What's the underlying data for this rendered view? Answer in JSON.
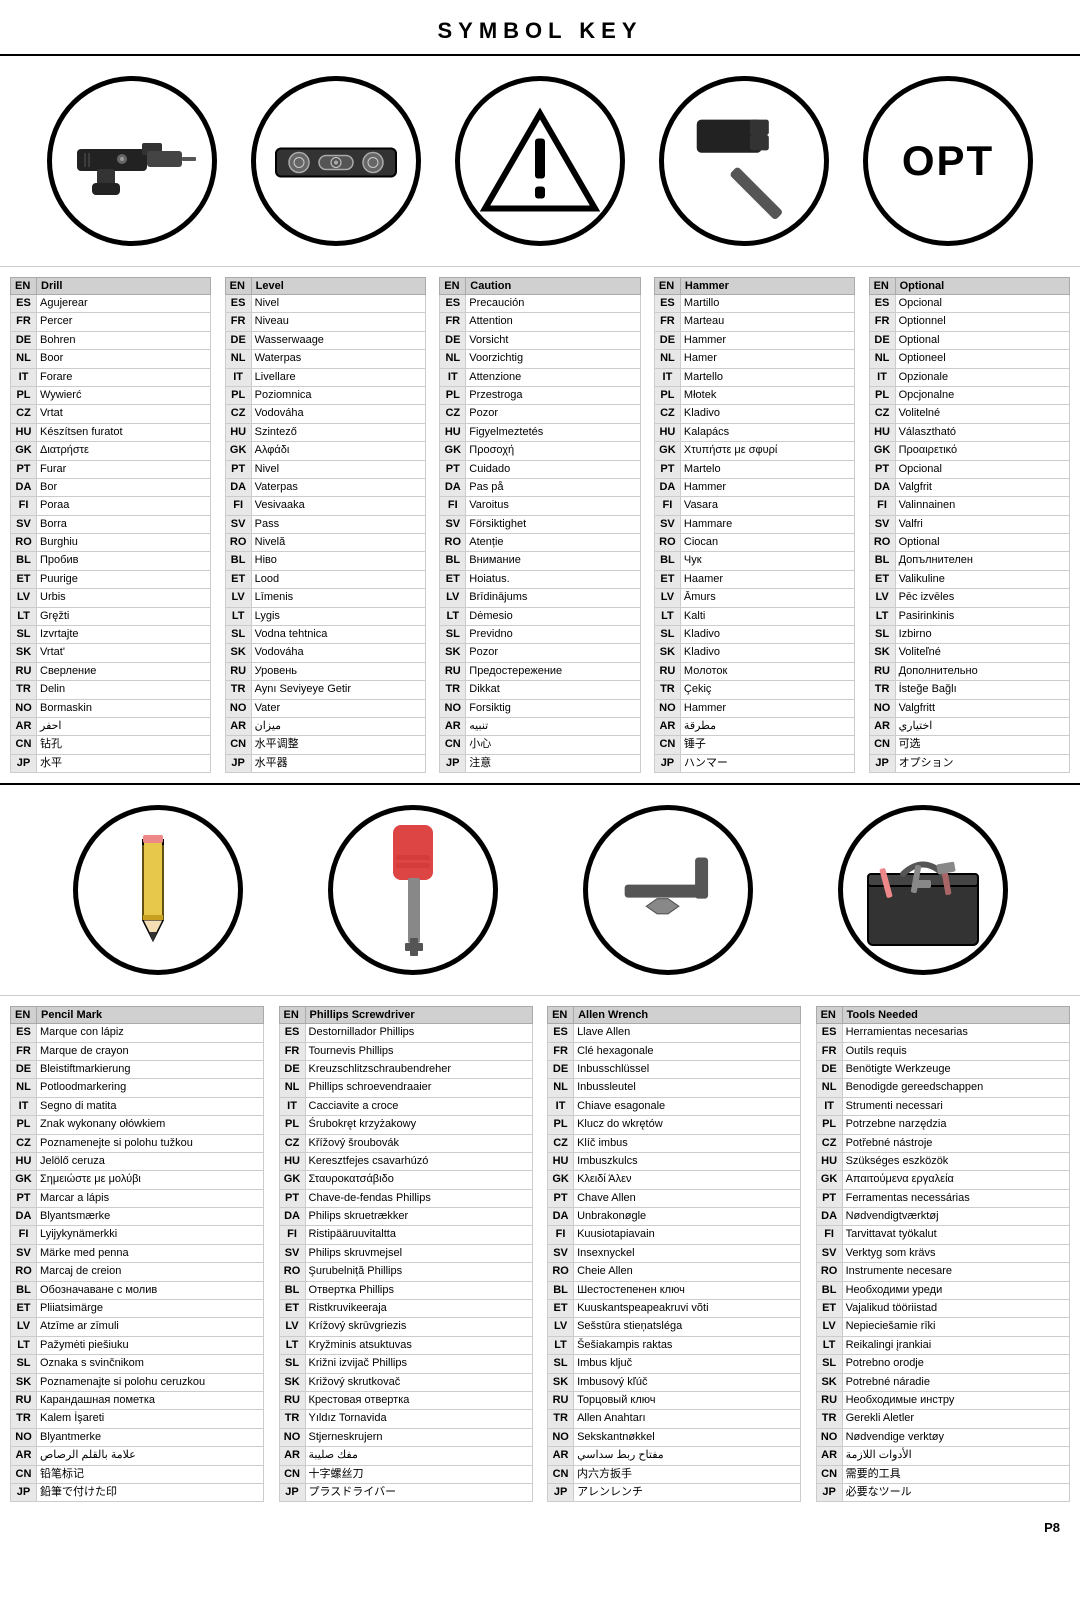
{
  "title": "SYMBOL KEY",
  "page_number": "P8",
  "top_symbols": [
    {
      "id": "drill",
      "label": "Drill",
      "translations": [
        [
          "ES",
          "Agujerear"
        ],
        [
          "FR",
          "Percer"
        ],
        [
          "DE",
          "Bohren"
        ],
        [
          "NL",
          "Boor"
        ],
        [
          "IT",
          "Forare"
        ],
        [
          "PL",
          "Wywierć"
        ],
        [
          "CZ",
          "Vrtat"
        ],
        [
          "HU",
          "Készítsen furatot"
        ],
        [
          "GK",
          "Διατρήστε"
        ],
        [
          "PT",
          "Furar"
        ],
        [
          "DA",
          "Bor"
        ],
        [
          "FI",
          "Poraa"
        ],
        [
          "SV",
          "Borra"
        ],
        [
          "RO",
          "Burghiu"
        ],
        [
          "BL",
          "Пробив"
        ],
        [
          "ET",
          "Puurige"
        ],
        [
          "LV",
          "Urbis"
        ],
        [
          "LT",
          "Gręžti"
        ],
        [
          "SL",
          "Izvrtajte"
        ],
        [
          "SK",
          "Vrtat'"
        ],
        [
          "RU",
          "Сверление"
        ],
        [
          "TR",
          "Delin"
        ],
        [
          "NO",
          "Bormaskin"
        ],
        [
          "AR",
          "احفر"
        ],
        [
          "CN",
          "钻孔"
        ],
        [
          "JP",
          "水平"
        ]
      ]
    },
    {
      "id": "level",
      "label": "Level",
      "translations": [
        [
          "ES",
          "Nivel"
        ],
        [
          "FR",
          "Niveau"
        ],
        [
          "DE",
          "Wasserwaage"
        ],
        [
          "NL",
          "Waterpas"
        ],
        [
          "IT",
          "Livellare"
        ],
        [
          "PL",
          "Poziomnica"
        ],
        [
          "CZ",
          "Vodováha"
        ],
        [
          "HU",
          "Szintező"
        ],
        [
          "GK",
          "Αλφάδι"
        ],
        [
          "PT",
          "Nivel"
        ],
        [
          "DA",
          "Vaterpas"
        ],
        [
          "FI",
          "Vesivaaka"
        ],
        [
          "SV",
          "Pass"
        ],
        [
          "RO",
          "Nivelă"
        ],
        [
          "BL",
          "Нiво"
        ],
        [
          "ET",
          "Lood"
        ],
        [
          "LV",
          "Līmenis"
        ],
        [
          "LT",
          "Lygis"
        ],
        [
          "SL",
          "Vodna tehtnica"
        ],
        [
          "SK",
          "Vodováha"
        ],
        [
          "RU",
          "Уровень"
        ],
        [
          "TR",
          "Aynı Seviyeye Getir"
        ],
        [
          "NO",
          "Vater"
        ],
        [
          "AR",
          "ميزان"
        ],
        [
          "CN",
          "水平调整"
        ],
        [
          "JP",
          "水平器"
        ]
      ]
    },
    {
      "id": "caution",
      "label": "Caution",
      "translations": [
        [
          "ES",
          "Precaución"
        ],
        [
          "FR",
          "Attention"
        ],
        [
          "DE",
          "Vorsicht"
        ],
        [
          "NL",
          "Voorzichtig"
        ],
        [
          "IT",
          "Attenzione"
        ],
        [
          "PL",
          "Przestroga"
        ],
        [
          "CZ",
          "Pozor"
        ],
        [
          "HU",
          "Figyelmeztetés"
        ],
        [
          "GK",
          "Προσοχή"
        ],
        [
          "PT",
          "Cuidado"
        ],
        [
          "DA",
          "Pas på"
        ],
        [
          "FI",
          "Varoitus"
        ],
        [
          "SV",
          "Försiktighet"
        ],
        [
          "RO",
          "Atenție"
        ],
        [
          "BL",
          "Внимание"
        ],
        [
          "ET",
          "Hoiatus."
        ],
        [
          "LV",
          "Brīdinājums"
        ],
        [
          "LT",
          "Dėmesio"
        ],
        [
          "SL",
          "Previdno"
        ],
        [
          "SK",
          "Pozor"
        ],
        [
          "RU",
          "Предостережение"
        ],
        [
          "TR",
          "Dikkat"
        ],
        [
          "NO",
          "Forsiktig"
        ],
        [
          "AR",
          "تنبيه"
        ],
        [
          "CN",
          "小心"
        ],
        [
          "JP",
          "注意"
        ]
      ]
    },
    {
      "id": "hammer",
      "label": "Hammer",
      "translations": [
        [
          "ES",
          "Martillo"
        ],
        [
          "FR",
          "Marteau"
        ],
        [
          "DE",
          "Hammer"
        ],
        [
          "NL",
          "Hamer"
        ],
        [
          "IT",
          "Martello"
        ],
        [
          "PL",
          "Młotek"
        ],
        [
          "CZ",
          "Kladivo"
        ],
        [
          "HU",
          "Kalapács"
        ],
        [
          "GK",
          "Χτυπήστε με σφυρί"
        ],
        [
          "PT",
          "Martelo"
        ],
        [
          "DA",
          "Hammer"
        ],
        [
          "FI",
          "Vasara"
        ],
        [
          "SV",
          "Hammare"
        ],
        [
          "RO",
          "Ciocan"
        ],
        [
          "BL",
          "Чук"
        ],
        [
          "ET",
          "Haamer"
        ],
        [
          "LV",
          "Āmurs"
        ],
        [
          "LT",
          "Kalti"
        ],
        [
          "SL",
          "Kladivo"
        ],
        [
          "SK",
          "Kladivo"
        ],
        [
          "RU",
          "Молоток"
        ],
        [
          "TR",
          "Çekiç"
        ],
        [
          "NO",
          "Hammer"
        ],
        [
          "AR",
          "مطرقة"
        ],
        [
          "CN",
          "锤子"
        ],
        [
          "JP",
          "ハンマー"
        ]
      ]
    },
    {
      "id": "optional",
      "label": "Optional",
      "translations": [
        [
          "ES",
          "Opcional"
        ],
        [
          "FR",
          "Optionnel"
        ],
        [
          "DE",
          "Optional"
        ],
        [
          "NL",
          "Optioneel"
        ],
        [
          "IT",
          "Opzionale"
        ],
        [
          "PL",
          "Opcjonalne"
        ],
        [
          "CZ",
          "Volitelné"
        ],
        [
          "HU",
          "Választható"
        ],
        [
          "GK",
          "Προαιρετικό"
        ],
        [
          "PT",
          "Opcional"
        ],
        [
          "DA",
          "Valgfrit"
        ],
        [
          "FI",
          "Valinnainen"
        ],
        [
          "SV",
          "Valfri"
        ],
        [
          "RO",
          "Optional"
        ],
        [
          "BL",
          "Допълнителен"
        ],
        [
          "ET",
          "Valikuline"
        ],
        [
          "LV",
          "Pēc izvēles"
        ],
        [
          "LT",
          "Pasirinkinis"
        ],
        [
          "SL",
          "Izbirno"
        ],
        [
          "SK",
          "Voliteľné"
        ],
        [
          "RU",
          "Дополнительно"
        ],
        [
          "TR",
          "İsteğe Bağlı"
        ],
        [
          "NO",
          "Valgfritt"
        ],
        [
          "AR",
          "اختياري"
        ],
        [
          "CN",
          "可选"
        ],
        [
          "JP",
          "オプション"
        ]
      ]
    }
  ],
  "bottom_symbols": [
    {
      "id": "pencil",
      "label": "Pencil Mark",
      "translations": [
        [
          "ES",
          "Marque con lápiz"
        ],
        [
          "FR",
          "Marque de crayon"
        ],
        [
          "DE",
          "Bleistiftmarkierung"
        ],
        [
          "NL",
          "Potloodmarkering"
        ],
        [
          "IT",
          "Segno di matita"
        ],
        [
          "PL",
          "Znak wykonany ołówkiem"
        ],
        [
          "CZ",
          "Poznamenejte si polohu tužkou"
        ],
        [
          "HU",
          "Jelölő ceruza"
        ],
        [
          "GK",
          "Σημειώστε με μολύβι"
        ],
        [
          "PT",
          "Marcar a lápis"
        ],
        [
          "DA",
          "Blyantsmærke"
        ],
        [
          "FI",
          "Lyijykynämerkki"
        ],
        [
          "SV",
          "Märke med penna"
        ],
        [
          "RO",
          "Marcaj de creion"
        ],
        [
          "BL",
          "Обозначаване с молив"
        ],
        [
          "ET",
          "Pliiatsimärge"
        ],
        [
          "LV",
          "Atzīme ar zīmuli"
        ],
        [
          "LT",
          "Pažymėti piešiuku"
        ],
        [
          "SL",
          "Oznaka s svinčnikom"
        ],
        [
          "SK",
          "Poznamenajte si polohu ceruzkou"
        ],
        [
          "RU",
          "Карандашная пометка"
        ],
        [
          "TR",
          "Kalem İşareti"
        ],
        [
          "NO",
          "Blyantmerke"
        ],
        [
          "AR",
          "علامة بالقلم الرصاص"
        ],
        [
          "CN",
          "铅笔标记"
        ],
        [
          "JP",
          "鉛筆で付けた印"
        ]
      ]
    },
    {
      "id": "phillips",
      "label": "Phillips Screwdriver",
      "translations": [
        [
          "ES",
          "Destornillador Phillips"
        ],
        [
          "FR",
          "Tournevis Phillips"
        ],
        [
          "DE",
          "Kreuzschlitzschraubendreher"
        ],
        [
          "NL",
          "Phillips schroevendraaier"
        ],
        [
          "IT",
          "Cacciavite a croce"
        ],
        [
          "PL",
          "Śrubokręt krzyżakowy"
        ],
        [
          "CZ",
          "Křížový šroubovák"
        ],
        [
          "HU",
          "Keresztfejes csavarhúzó"
        ],
        [
          "GK",
          "Σταυροκατσάβιδο"
        ],
        [
          "PT",
          "Chave-de-fendas Phillips"
        ],
        [
          "DA",
          "Philips skruetrækker"
        ],
        [
          "FI",
          "Ristipääruuvitaltta"
        ],
        [
          "SV",
          "Philips skruvmejsel"
        ],
        [
          "RO",
          "Şurubelniță Phillips"
        ],
        [
          "BL",
          "Отвертка Phillips"
        ],
        [
          "ET",
          "Ristkruvikeeraja"
        ],
        [
          "LV",
          "Krížový skrūvgriezis"
        ],
        [
          "LT",
          "Kryžminis atsuktuvas"
        ],
        [
          "SL",
          "Križni izvijač Phillips"
        ],
        [
          "SK",
          "Križový skrutkovač"
        ],
        [
          "RU",
          "Крестовая отвертка"
        ],
        [
          "TR",
          "Yıldız Tornavida"
        ],
        [
          "NO",
          "Stjerneskrujern"
        ],
        [
          "AR",
          "مفك صليبة"
        ],
        [
          "CN",
          "十字螺丝刀"
        ],
        [
          "JP",
          "プラスドライバー"
        ]
      ]
    },
    {
      "id": "allen",
      "label": "Allen Wrench",
      "translations": [
        [
          "ES",
          "Llave Allen"
        ],
        [
          "FR",
          "Clé hexagonale"
        ],
        [
          "DE",
          "Inbusschlüssel"
        ],
        [
          "NL",
          "Inbussleutel"
        ],
        [
          "IT",
          "Chiave esagonale"
        ],
        [
          "PL",
          "Klucz do wkrętów"
        ],
        [
          "CZ",
          "Klíč imbus"
        ],
        [
          "HU",
          "Imbuszkulcs"
        ],
        [
          "GK",
          "Κλειδί Άλεν"
        ],
        [
          "PT",
          "Chave Allen"
        ],
        [
          "DA",
          "Unbrakonøgle"
        ],
        [
          "FI",
          "Kuusiotapiavain"
        ],
        [
          "SV",
          "Insexnyckel"
        ],
        [
          "RO",
          "Cheie Allen"
        ],
        [
          "BL",
          "Шестостепенен ключ"
        ],
        [
          "ET",
          "Kuuskantspeapeakruvi võti"
        ],
        [
          "LV",
          "Sešstūra stieņatsléga"
        ],
        [
          "LT",
          "Šešiakampis raktas"
        ],
        [
          "SL",
          "Imbus ključ"
        ],
        [
          "SK",
          "Imbusový kľúč"
        ],
        [
          "RU",
          "Торцовый ключ"
        ],
        [
          "TR",
          "Allen Anahtarı"
        ],
        [
          "NO",
          "Sekskantnøkkel"
        ],
        [
          "AR",
          "مفتاح ربط سداسي"
        ],
        [
          "CN",
          "内六方扳手"
        ],
        [
          "JP",
          "アレンレンチ"
        ]
      ]
    },
    {
      "id": "tools",
      "label": "Tools Needed",
      "translations": [
        [
          "ES",
          "Herramientas necesarias"
        ],
        [
          "FR",
          "Outils requis"
        ],
        [
          "DE",
          "Benötigte Werkzeuge"
        ],
        [
          "NL",
          "Benodigde gereedschappen"
        ],
        [
          "IT",
          "Strumenti necessari"
        ],
        [
          "PL",
          "Potrzebne narzędzia"
        ],
        [
          "CZ",
          "Potřebné nástroje"
        ],
        [
          "HU",
          "Szükséges eszközök"
        ],
        [
          "GK",
          "Απαιτούμενα εργαλεία"
        ],
        [
          "PT",
          "Ferramentas necessárias"
        ],
        [
          "DA",
          "Nødvendigtværktøj"
        ],
        [
          "FI",
          "Tarvittavat työkalut"
        ],
        [
          "SV",
          "Verktyg som krävs"
        ],
        [
          "RO",
          "Instrumente necesare"
        ],
        [
          "BL",
          "Необходими уреди"
        ],
        [
          "ET",
          "Vajalikud tööriistad"
        ],
        [
          "LV",
          "Nepieciešamie rīki"
        ],
        [
          "LT",
          "Reikalingi įrankiai"
        ],
        [
          "SL",
          "Potrebno orodje"
        ],
        [
          "SK",
          "Potrebné náradie"
        ],
        [
          "RU",
          "Необходимые инстру"
        ],
        [
          "TR",
          "Gerekli Aletler"
        ],
        [
          "NO",
          "Nødvendige verktøy"
        ],
        [
          "AR",
          "الأدوات اللازمة"
        ],
        [
          "CN",
          "需要的工具"
        ],
        [
          "JP",
          "必要なツール"
        ]
      ]
    }
  ]
}
